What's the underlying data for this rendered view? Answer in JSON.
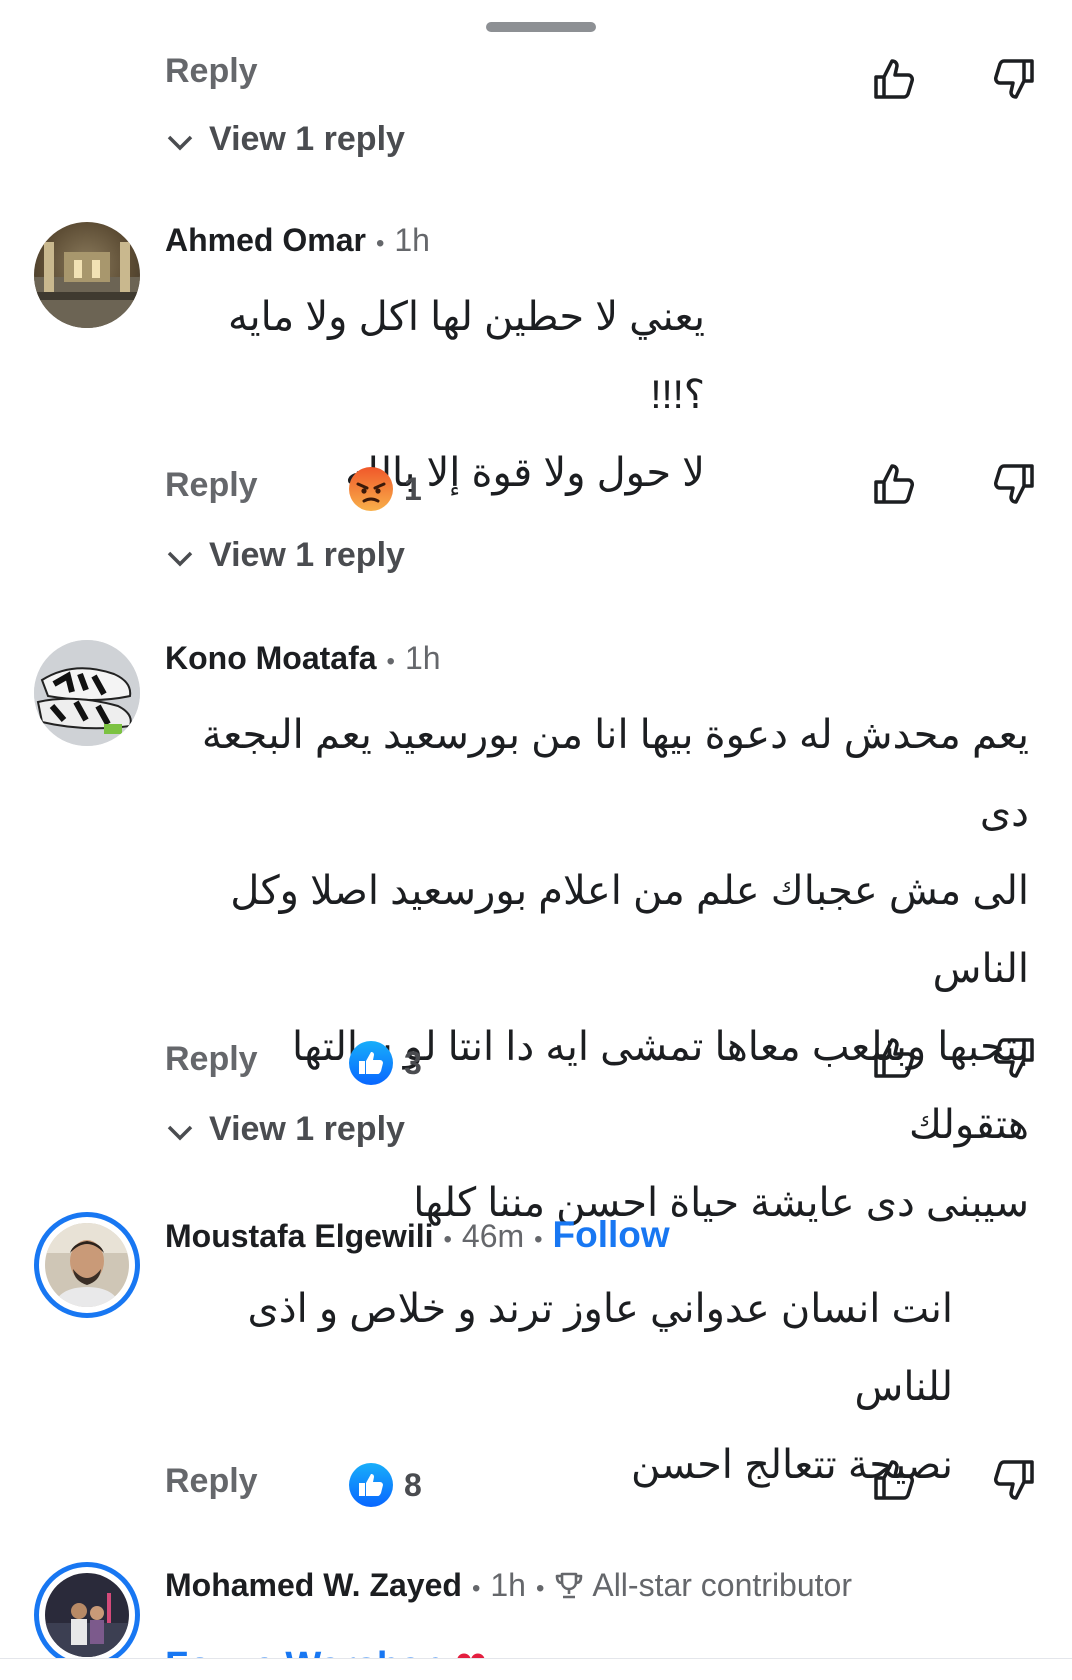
{
  "first_thread": {
    "reply_label": "Reply",
    "view_replies_label": "View 1 reply"
  },
  "comments": [
    {
      "author": "Ahmed Omar",
      "time": "1h",
      "lines": [
        "يعني لا حطين لها اكل ولا مايه ؟!!!",
        "لا حول ولا قوة إلا بالله"
      ],
      "reply_label": "Reply",
      "reaction_icon": "angry-emoji-icon",
      "reaction_count": "1",
      "view_replies_label": "View 1 reply"
    },
    {
      "author": "Kono Moatafa",
      "time": "1h",
      "lines": [
        "يعم محدش له دعوة بيها انا من بورسعيد يعم البجعة دى",
        "الى مش عجباك علم من اعلام بورسعيد اصلا وكل الناس",
        "بتحبها وبنلعب معاها تمشى ايه دا انتا لو سالتها هتقولك",
        "سيبنى دى عايشة حياة احسن مننا كلها"
      ],
      "reply_label": "Reply",
      "reaction_icon": "like-reaction-icon",
      "reaction_count": "3",
      "view_replies_label": "View 1 reply"
    },
    {
      "author": "Moustafa Elgewili",
      "time": "46m",
      "follow_label": "Follow",
      "lines": [
        "انت انسان عدواني عاوز ترند و خلاص و اذى للناس",
        "نصيحة تتعالج احسن"
      ],
      "reply_label": "Reply",
      "reaction_icon": "like-reaction-icon",
      "reaction_count": "8"
    },
    {
      "author": "Mohamed W. Zayed",
      "time": "1h",
      "badge_icon": "trophy-icon",
      "badge_label": "All-star contributor",
      "partial_line": "Fouze Warshan"
    }
  ],
  "colors": {
    "accent_blue": "#1877f2",
    "secondary_text": "#65676b",
    "angry_orange": "#f0582a"
  }
}
